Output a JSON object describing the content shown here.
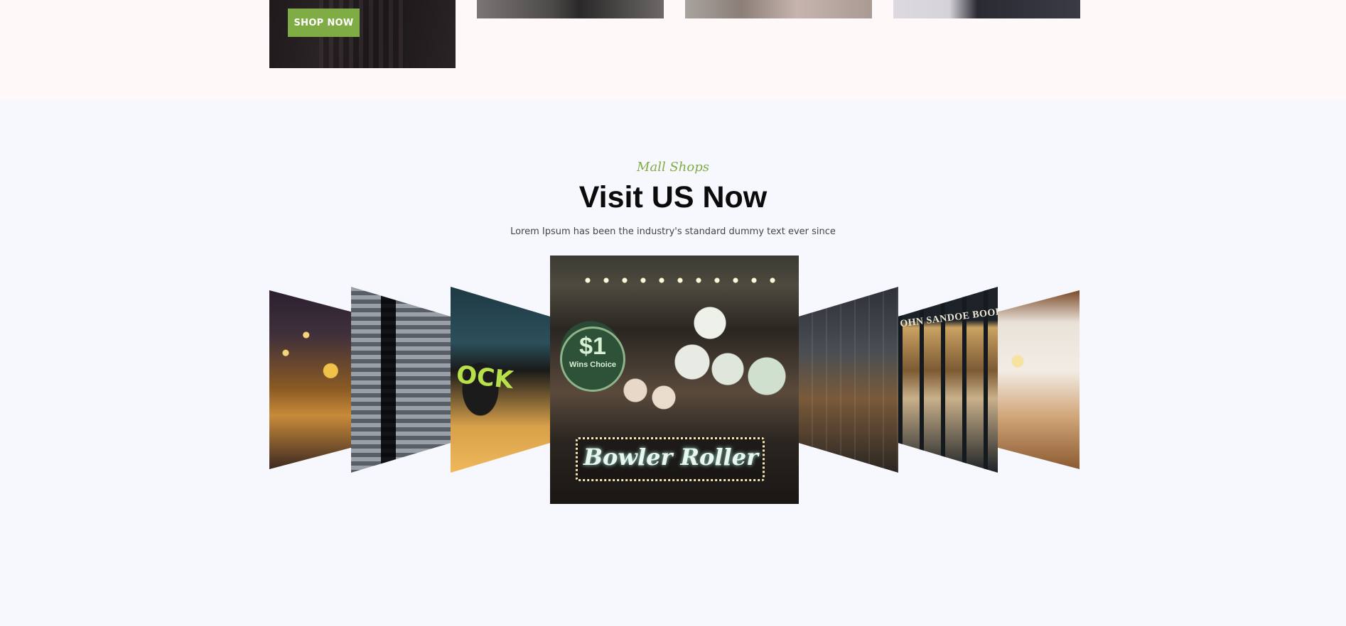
{
  "promo": {
    "shop_button_label": "SHOP NOW"
  },
  "section": {
    "kicker": "Mall Shops",
    "heading": "Visit US Now",
    "subtext": "Lorem Ipsum has been the industry's standard dummy text ever since"
  },
  "carousel": {
    "slides": [
      {
        "sign_text": ""
      },
      {
        "sign_text": ""
      },
      {
        "sign_text": "OCK"
      },
      {
        "sign_text": "Bowler Roller",
        "coin_big": "$1",
        "coin_small": "Wins Choice"
      },
      {
        "sign_text": ""
      },
      {
        "sign_text": "OHN SANDOE BOOKS"
      },
      {
        "sign_text": ""
      }
    ]
  },
  "colors": {
    "accent": "#7fac44",
    "top_background": "#fff8f8",
    "section_background": "#f7f8fd",
    "heading": "#0b0b0b"
  }
}
